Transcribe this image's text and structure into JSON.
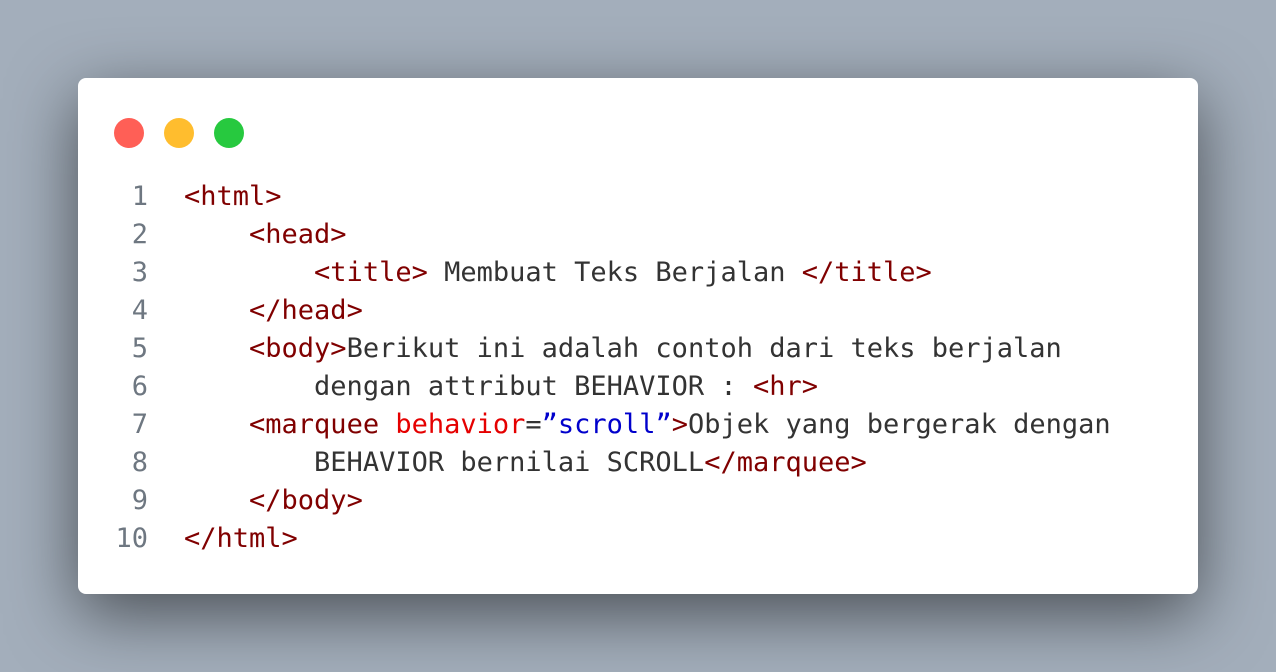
{
  "window": {
    "controls": {
      "close_color": "#ff5f56",
      "minimize_color": "#ffbd2e",
      "maximize_color": "#27c93f"
    }
  },
  "code": {
    "lines": [
      {
        "number": "1",
        "indent": "",
        "parts": [
          {
            "type": "tag",
            "text": "<html>"
          }
        ]
      },
      {
        "number": "2",
        "indent": "    ",
        "parts": [
          {
            "type": "tag",
            "text": "<head>"
          }
        ]
      },
      {
        "number": "3",
        "indent": "        ",
        "parts": [
          {
            "type": "tag",
            "text": "<title>"
          },
          {
            "type": "txt",
            "text": " Membuat Teks Berjalan "
          },
          {
            "type": "tag",
            "text": "</title>"
          }
        ]
      },
      {
        "number": "4",
        "indent": "    ",
        "parts": [
          {
            "type": "tag",
            "text": "</head>"
          }
        ]
      },
      {
        "number": "5",
        "indent": "    ",
        "parts": [
          {
            "type": "tag",
            "text": "<body>"
          },
          {
            "type": "txt",
            "text": "Berikut ini adalah contoh dari teks berjalan"
          }
        ]
      },
      {
        "number": "6",
        "indent": "        ",
        "parts": [
          {
            "type": "txt",
            "text": "dengan attribut BEHAVIOR : "
          },
          {
            "type": "tag",
            "text": "<hr>"
          }
        ]
      },
      {
        "number": "7",
        "indent": "    ",
        "parts": [
          {
            "type": "tag",
            "text": "<marquee "
          },
          {
            "type": "attr",
            "text": "behavior"
          },
          {
            "type": "punc",
            "text": "="
          },
          {
            "type": "str",
            "text": "”scroll”"
          },
          {
            "type": "tag",
            "text": ">"
          },
          {
            "type": "txt",
            "text": "Objek yang bergerak dengan"
          }
        ]
      },
      {
        "number": "8",
        "indent": "        ",
        "parts": [
          {
            "type": "txt",
            "text": "BEHAVIOR bernilai SCROLL"
          },
          {
            "type": "tag",
            "text": "</marquee>"
          }
        ]
      },
      {
        "number": "9",
        "indent": "    ",
        "parts": [
          {
            "type": "tag",
            "text": "</body>"
          }
        ]
      },
      {
        "number": "10",
        "indent": "",
        "parts": [
          {
            "type": "tag",
            "text": "</html>"
          }
        ]
      }
    ]
  },
  "colors": {
    "background": "#a3aebb",
    "card": "#ffffff",
    "tag": "#800000",
    "attribute": "#e50000",
    "string": "#0000cc",
    "text": "#333333",
    "line_number": "#6e7781"
  }
}
